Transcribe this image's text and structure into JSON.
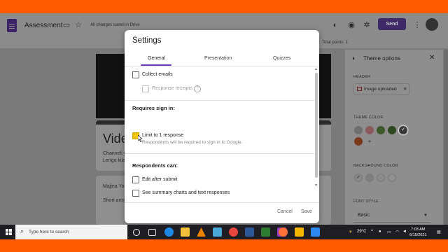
{
  "header": {
    "form_title": "Assessment",
    "save_status": "All changes saved in Drive",
    "send_label": "Send",
    "total_points": "Total points: 1"
  },
  "form": {
    "title_fragment": "Vide",
    "desc_line1": "Channeli y",
    "desc_line2": "Lengo kila",
    "question_fragment": "Majina Yo",
    "answer_placeholder": "Short answ"
  },
  "theme_panel": {
    "title": "Theme options",
    "header_label": "HEADER",
    "header_chip": "Image uploaded",
    "theme_color_label": "THEME COLOR",
    "bg_color_label": "BACKGROUND COLOR",
    "font_style_label": "FONT STYLE",
    "font_value": "Basic",
    "theme_colors": [
      "#6e6e6e",
      "#8a5a5a",
      "#3d5a2a",
      "#2e4a22",
      "#3a3a3a",
      "#7a3a1a"
    ],
    "bg_colors": [
      "#888888",
      "#7e7e7e",
      "#8a8a8a",
      "#909090"
    ]
  },
  "dialog": {
    "title": "Settings",
    "tabs": [
      "General",
      "Presentation",
      "Quizzes"
    ],
    "collect_emails": "Collect emails",
    "response_receipts": "Response receipts",
    "requires_sign_in": "Requires sign in:",
    "limit_one": "Limit to 1 response",
    "limit_hint": "Respondents will be required to sign in to Google.",
    "respondents_can": "Respondents can:",
    "edit_after_submit": "Edit after submit",
    "see_summary": "See summary charts and text responses",
    "cancel_label": "Cancel",
    "save_label": "Save",
    "accent": "#673ab7"
  },
  "taskbar": {
    "search_placeholder": "Type here to search",
    "temperature": "29°C",
    "time": "7:03 AM",
    "date": "6/15/2021"
  }
}
